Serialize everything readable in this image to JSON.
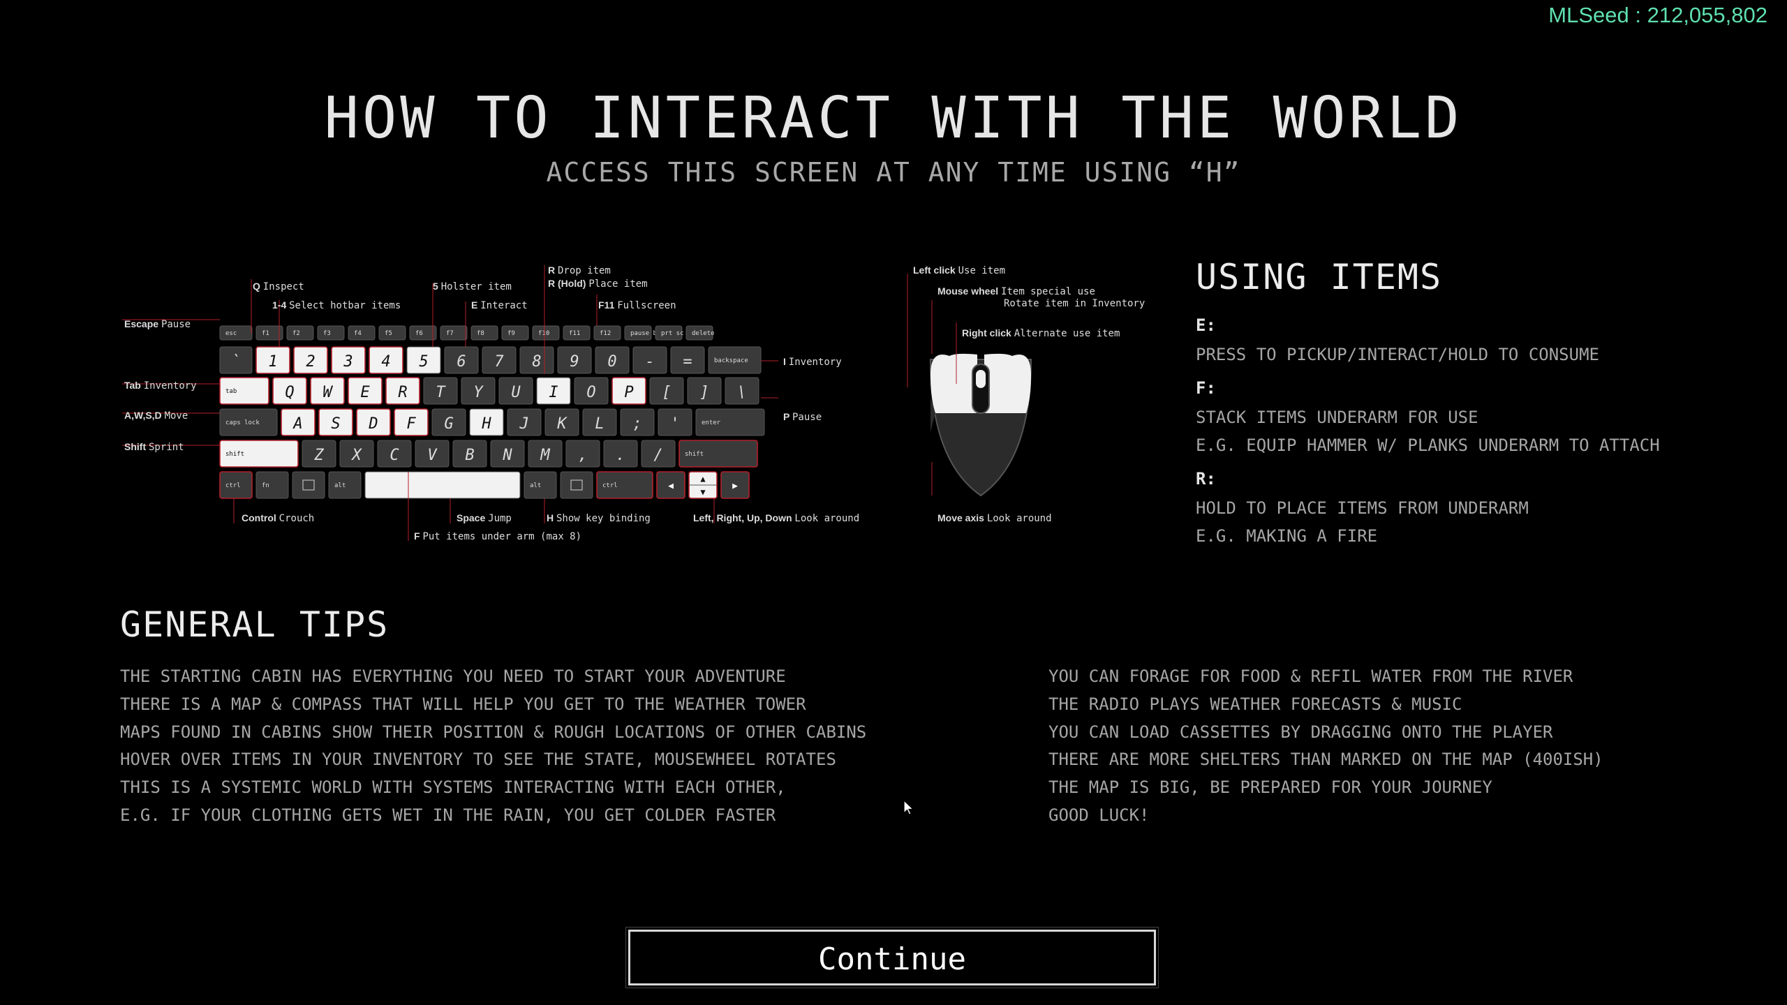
{
  "seed": "MLSeed : 212,055,802",
  "title": "HOW TO INTERACT WITH THE WORLD",
  "subtitle": "ACCESS THIS SCREEN AT ANY TIME USING “H”",
  "keyboard": {
    "rows": [
      [
        "esc",
        "f1",
        "f2",
        "f3",
        "f4",
        "f5",
        "f6",
        "f7",
        "f8",
        "f9",
        "f10",
        "f11",
        "f12",
        "pause break",
        "prt sc sysrq",
        "delete"
      ],
      [
        "`",
        "1",
        "2",
        "3",
        "4",
        "5",
        "6",
        "7",
        "8",
        "9",
        "0",
        "-",
        "=",
        "backspace"
      ],
      [
        "tab",
        "Q",
        "W",
        "E",
        "R",
        "T",
        "Y",
        "U",
        "I",
        "O",
        "P",
        "[",
        "]",
        "\\"
      ],
      [
        "caps lock",
        "A",
        "S",
        "D",
        "F",
        "G",
        "H",
        "J",
        "K",
        "L",
        ";",
        "'",
        "enter"
      ],
      [
        "shift",
        "Z",
        "X",
        "C",
        "V",
        "B",
        "N",
        "M",
        ",",
        ".",
        "/",
        "shift"
      ],
      [
        "ctrl",
        "fn",
        "menu",
        "alt",
        "space",
        "alt",
        "menu",
        "ctrl",
        "left",
        "up-down",
        "right"
      ]
    ],
    "labels": [
      {
        "key": "Q",
        "text": "Inspect"
      },
      {
        "key": "1-4",
        "text": "Select hotbar items"
      },
      {
        "key": "5",
        "text": "Holster item"
      },
      {
        "key": "E",
        "text": "Interact"
      },
      {
        "key": "R",
        "text": "Drop item"
      },
      {
        "key": "R (Hold)",
        "text": "Place item"
      },
      {
        "key": "F11",
        "text": "Fullscreen"
      },
      {
        "key": "Escape",
        "text": "Pause"
      },
      {
        "key": "Tab",
        "text": "Inventory"
      },
      {
        "key": "A,W,S,D",
        "text": "Move"
      },
      {
        "key": "Shift",
        "text": "Sprint"
      },
      {
        "key": "I",
        "text": "Inventory"
      },
      {
        "key": "P",
        "text": "Pause"
      },
      {
        "key": "Control",
        "text": "Crouch"
      },
      {
        "key": "Space",
        "text": "Jump"
      },
      {
        "key": "H",
        "text": "Show key binding"
      },
      {
        "key": "F",
        "text": "Put items under arm (max 8)"
      },
      {
        "key": "Left, Right, Up, Down",
        "text": "Look around"
      }
    ]
  },
  "mouse": {
    "labels": [
      {
        "key": "Left click",
        "text": "Use item"
      },
      {
        "key": "Mouse wheel",
        "text": "Item special use",
        "text2": "Rotate item in Inventory"
      },
      {
        "key": "Right click",
        "text": "Alternate use item"
      },
      {
        "key": "Move axis",
        "text": "Look around"
      }
    ]
  },
  "using_items": {
    "title": "USING ITEMS",
    "sections": [
      {
        "key": "E:",
        "lines": [
          "PRESS TO PICKUP/INTERACT/HOLD TO CONSUME"
        ]
      },
      {
        "key": "F:",
        "lines": [
          "STACK ITEMS UNDERARM FOR USE",
          "E.G. EQUIP HAMMER W/ PLANKS UNDERARM TO ATTACH"
        ]
      },
      {
        "key": "R:",
        "lines": [
          "HOLD TO PLACE ITEMS FROM UNDERARM",
          "E.G. MAKING A FIRE"
        ]
      }
    ]
  },
  "tips": {
    "title": "GENERAL TIPS",
    "left": [
      "THE STARTING CABIN HAS EVERYTHING YOU NEED TO START YOUR ADVENTURE",
      "THERE IS A MAP & COMPASS THAT WILL HELP YOU GET TO THE WEATHER TOWER",
      "MAPS FOUND IN CABINS SHOW THEIR POSITION & ROUGH LOCATIONS OF OTHER CABINS",
      "HOVER OVER ITEMS IN YOUR INVENTORY TO SEE THE STATE, MOUSEWHEEL ROTATES",
      "THIS IS A SYSTEMIC WORLD WITH SYSTEMS INTERACTING WITH EACH OTHER,",
      "E.G. IF YOUR CLOTHING GETS WET IN THE RAIN, YOU GET COLDER FASTER"
    ],
    "right": [
      "YOU CAN FORAGE FOR FOOD & REFIL WATER FROM THE RIVER",
      "THE RADIO PLAYS WEATHER FORECASTS & MUSIC",
      "YOU CAN LOAD CASSETTES BY DRAGGING ONTO THE PLAYER",
      "THERE ARE MORE SHELTERS THAN MARKED ON THE MAP (400ISH)",
      "THE MAP IS BIG, BE PREPARED FOR YOUR JOURNEY",
      "GOOD LUCK!"
    ]
  },
  "continue_label": "Continue",
  "colors": {
    "background": "#000000",
    "seed": "#5fe0b0",
    "accent_line": "#b3202a",
    "key_dark": "#3a3a3a",
    "key_light": "#f2f2f2"
  }
}
